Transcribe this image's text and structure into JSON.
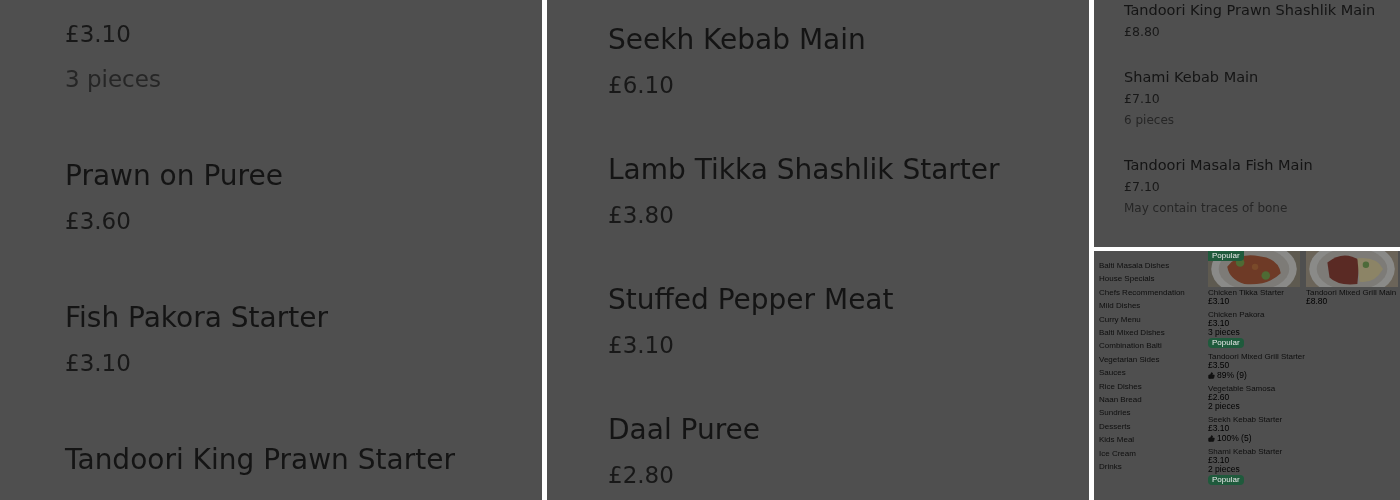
{
  "panels": [
    {
      "kind": "large",
      "items": [
        {
          "price": "£3.10",
          "note": "3 pieces"
        },
        {
          "title": "Prawn on Puree",
          "price": "£3.60"
        },
        {
          "title": "Fish Pakora Starter",
          "price": "£3.10"
        },
        {
          "title": "Tandoori King Prawn Starter"
        }
      ]
    },
    {
      "kind": "large",
      "items": [
        {
          "title": "Seekh Kebab Main",
          "price": "£6.10"
        },
        {
          "title": "Lamb Tikka Shashlik Starter",
          "price": "£3.80"
        },
        {
          "title": "Stuffed Pepper Meat",
          "price": "£3.10"
        },
        {
          "title": "Daal Puree",
          "price": "£2.80"
        }
      ]
    },
    {
      "kind": "medium",
      "items": [
        {
          "title": "Tandoori King Prawn Shashlik Main",
          "price": "£8.80"
        },
        {
          "title": "Shami Kebab Main",
          "price": "£7.10",
          "note": "6 pieces"
        },
        {
          "title": "Tandoori Masala Fish Main",
          "price": "£7.10",
          "note": "May contain traces of bone"
        }
      ]
    },
    {
      "kind": "menu",
      "categories": [
        "Balti Masala Dishes",
        "House Specials",
        "Chefs Recommendation",
        "Mild Dishes",
        "Curry Menu",
        "Balti Mixed Dishes",
        "Combination Balti",
        "Vegetarian Sides",
        "Sauces",
        "Rice Dishes",
        "Naan Bread",
        "Sundries",
        "Desserts",
        "Kids Meal",
        "Ice Cream",
        "Drinks"
      ],
      "featured": [
        {
          "title": "Chicken Tikka Starter",
          "price": "£3.10",
          "badge": "Popular"
        },
        {
          "title": "Tandoori Mixed Grill Main",
          "price": "£8.80"
        }
      ],
      "items": [
        {
          "title": "Chicken Pakora",
          "price": "£3.10",
          "note": "3 pieces",
          "badge": "Popular"
        },
        {
          "title": "Tandoori Mixed Grill Starter",
          "price": "£3.50",
          "rating": "89% (9)"
        },
        {
          "title": "Vegetable Samosa",
          "price": "£2.60",
          "note": "2 pieces"
        },
        {
          "title": "Seekh Kebab Starter",
          "price": "£3.10",
          "rating": "100% (5)"
        },
        {
          "title": "Shami Kebab Starter",
          "price": "£3.10",
          "note": "2 pieces",
          "badge": "Popular"
        }
      ]
    }
  ]
}
